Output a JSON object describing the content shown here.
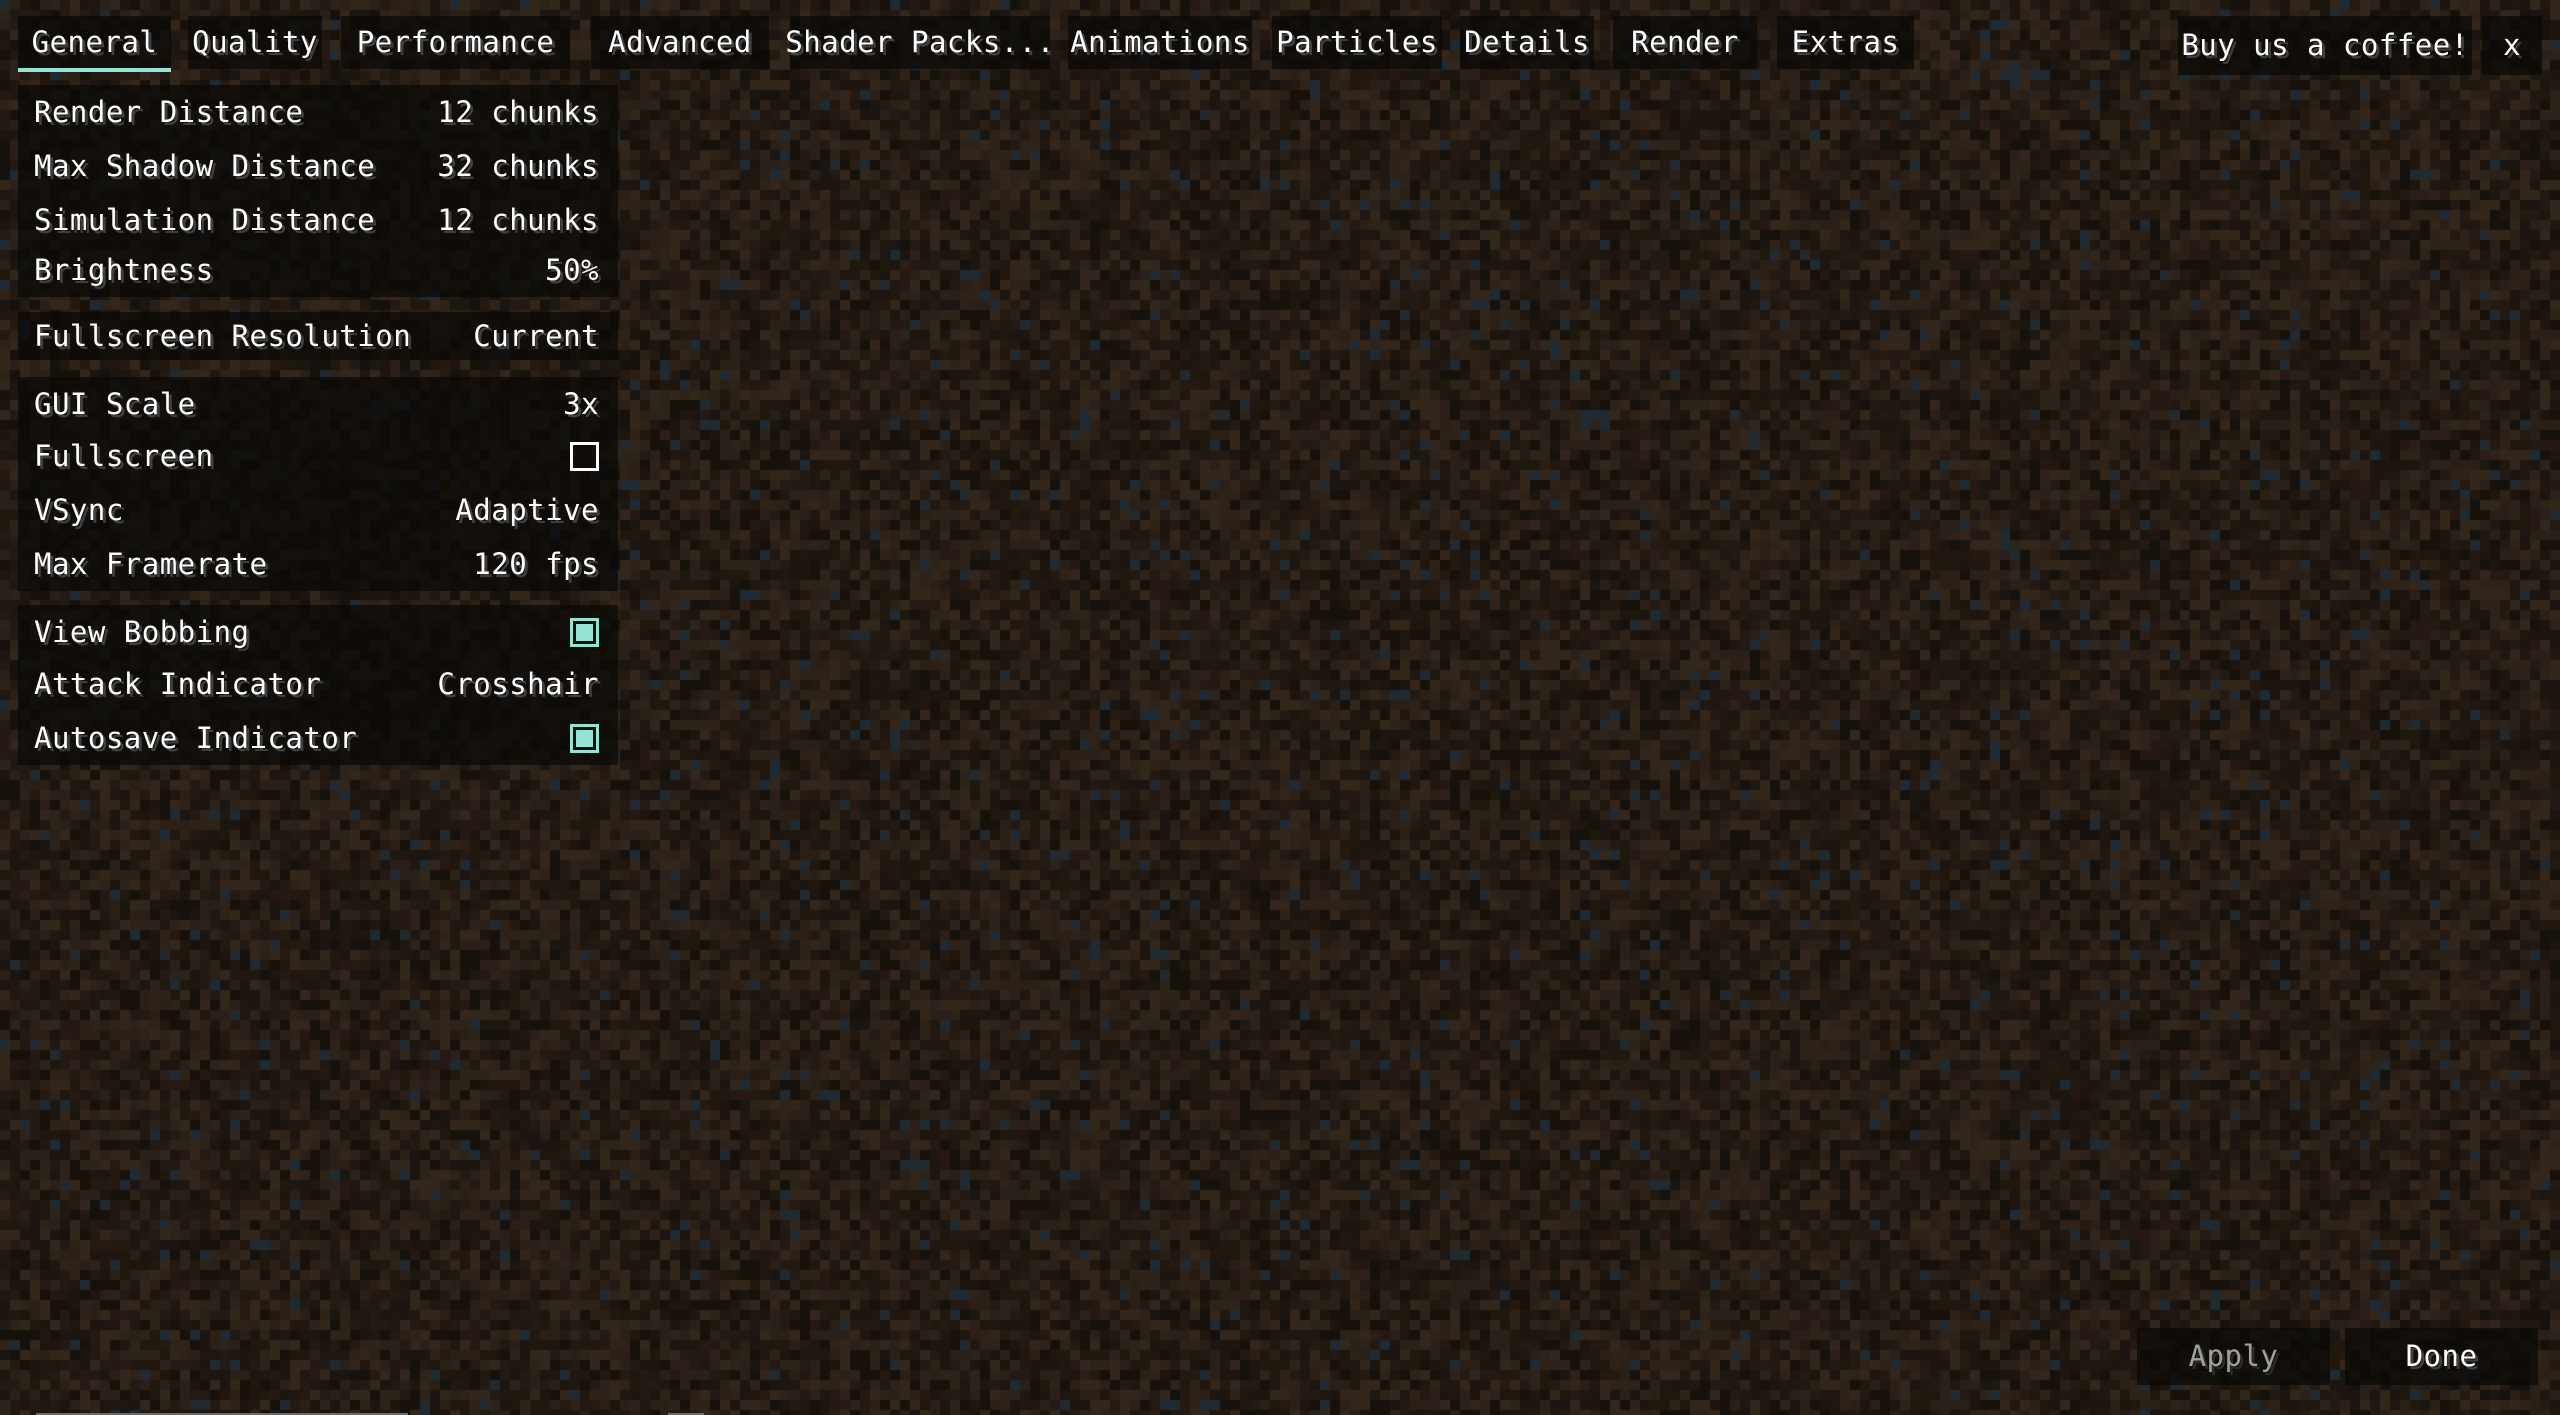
{
  "tabs": [
    {
      "label": "General",
      "active": true
    },
    {
      "label": "Quality",
      "active": false
    },
    {
      "label": "Performance",
      "active": false
    },
    {
      "label": "Advanced",
      "active": false
    },
    {
      "label": "Shader Packs...",
      "active": false
    },
    {
      "label": "Animations",
      "active": false
    },
    {
      "label": "Particles",
      "active": false
    },
    {
      "label": "Details",
      "active": false
    },
    {
      "label": "Render",
      "active": false
    },
    {
      "label": "Extras",
      "active": false
    }
  ],
  "header": {
    "donate_label": "Buy us a coffee!",
    "close_label": "x"
  },
  "options": {
    "groups": [
      {
        "rows": [
          {
            "label": "Render Distance",
            "value": "12 chunks",
            "type": "slider"
          },
          {
            "label": "Max Shadow Distance",
            "value": "32 chunks",
            "type": "slider"
          },
          {
            "label": "Simulation Distance",
            "value": "12 chunks",
            "type": "slider"
          },
          {
            "label": "Brightness",
            "value": "50%",
            "type": "slider"
          }
        ]
      },
      {
        "rows": [
          {
            "label": "Fullscreen Resolution",
            "value": "Current",
            "type": "slider"
          }
        ]
      },
      {
        "rows": [
          {
            "label": "GUI Scale",
            "value": "3x",
            "type": "cycle"
          },
          {
            "label": "Fullscreen",
            "checked": false,
            "type": "checkbox"
          },
          {
            "label": "VSync",
            "value": "Adaptive",
            "type": "cycle"
          },
          {
            "label": "Max Framerate",
            "value": "120 fps",
            "type": "slider"
          }
        ]
      },
      {
        "rows": [
          {
            "label": "View Bobbing",
            "checked": true,
            "type": "checkbox"
          },
          {
            "label": "Attack Indicator",
            "value": "Crosshair",
            "type": "cycle"
          },
          {
            "label": "Autosave Indicator",
            "checked": true,
            "type": "checkbox"
          }
        ]
      }
    ]
  },
  "footer": {
    "apply_label": "Apply",
    "apply_enabled": false,
    "done_label": "Done"
  },
  "colors": {
    "accent": "#94e4d3",
    "text": "#ffffff",
    "disabled_text": "#a0a0a0",
    "panel": "#0a0806"
  }
}
